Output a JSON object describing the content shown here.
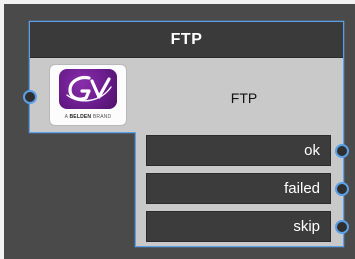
{
  "node": {
    "header_title": "FTP",
    "title": "FTP",
    "logo": {
      "brand_line_prefix": "A",
      "brand_line_bold": "BELDEN",
      "brand_line_suffix": "BRAND",
      "icon": "gv-logo"
    },
    "outputs": [
      {
        "label": "ok"
      },
      {
        "label": "failed"
      },
      {
        "label": "skip"
      }
    ]
  },
  "colors": {
    "outline": "#5aa0e8",
    "header_bg": "#3a3a3a",
    "node_bg": "#c9c9c9",
    "output_bg": "#3c3c3c",
    "canvas_bg": "#4a4a4a",
    "logo_purple": "#6a1c8c"
  }
}
